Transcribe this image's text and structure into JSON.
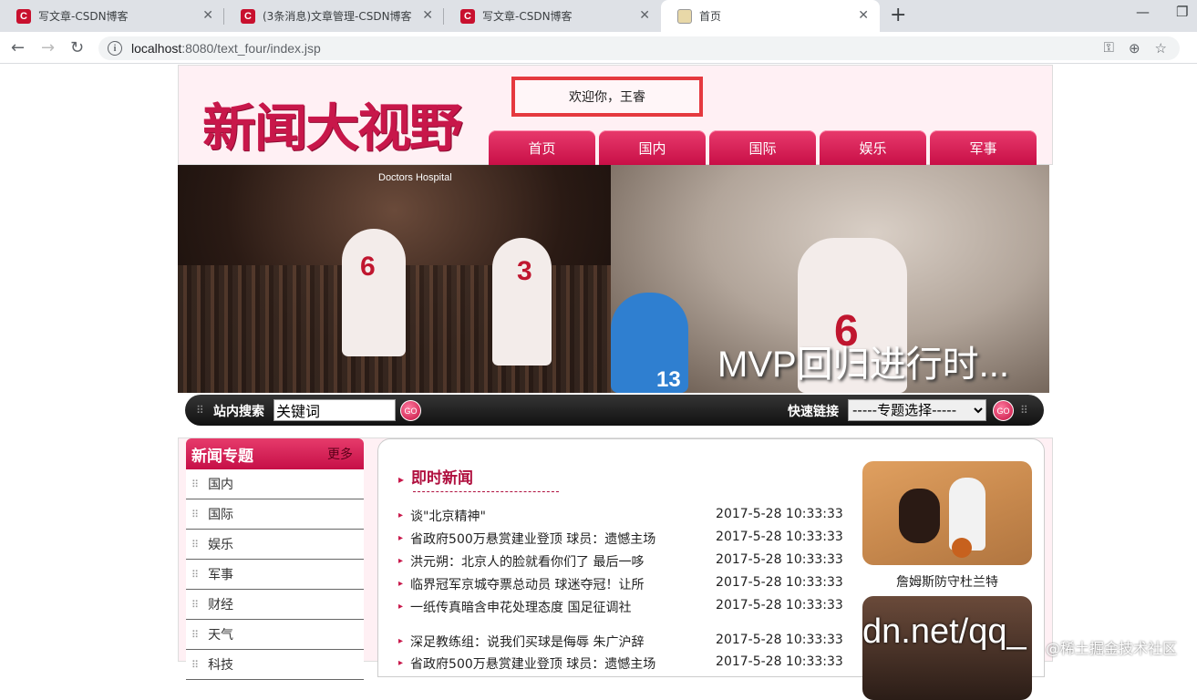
{
  "browser": {
    "tabs": [
      {
        "title": "写文章-CSDN博客",
        "favicon": "C"
      },
      {
        "title": "(3条消息)文章管理-CSDN博客",
        "favicon": "C"
      },
      {
        "title": "写文章-CSDN博客",
        "favicon": "C"
      },
      {
        "title": "首页",
        "favicon": ""
      }
    ],
    "url_host": "localhost",
    "url_path": ":8080/text_four/index.jsp"
  },
  "header": {
    "logo_text": "新闻大视野",
    "welcome": "欢迎你，王睿",
    "nav": [
      "首页",
      "国内",
      "国际",
      "娱乐",
      "军事"
    ]
  },
  "banner": {
    "caption": "MVP回归进行时...",
    "sponsor": "Doctors Hospital",
    "jersey_left": "6",
    "jersey_mid": "3",
    "jersey_right": "6",
    "jersey_opp": "13"
  },
  "search": {
    "label": "站内搜索",
    "input_value": "关键词",
    "go": "GO",
    "quick_label": "快速链接",
    "select_value": "-----专题选择-----"
  },
  "sidebar": {
    "title": "新闻专题",
    "more": "更多",
    "items": [
      "国内",
      "国际",
      "娱乐",
      "军事",
      "财经",
      "天气",
      "科技"
    ]
  },
  "news": {
    "title": "即时新闻",
    "items": [
      {
        "text": "谈\"北京精神\"",
        "date": "2017-5-28 10:33:33"
      },
      {
        "text": "省政府500万悬赏建业登顶 球员：遗憾主场",
        "date": "2017-5-28 10:33:33"
      },
      {
        "text": "洪元朔：北京人的脸就看你们了 最后一哆",
        "date": "2017-5-28 10:33:33"
      },
      {
        "text": "临界冠军京城夺票总动员 球迷夺冠！让所",
        "date": "2017-5-28 10:33:33"
      },
      {
        "text": "一纸传真暗含申花处理态度 国足征调社",
        "date": "2017-5-28 10:33:33"
      },
      {
        "text": "深足教练组：说我们买球是侮辱 朱广沪辞",
        "date": "2017-5-28 10:33:33"
      },
      {
        "text": "省政府500万悬赏建业登顶 球员：遗憾主场",
        "date": "2017-5-28 10:33:33"
      }
    ],
    "photo_caption": "詹姆斯防守杜兰特"
  },
  "watermark": {
    "text": "dn.net/qq_",
    "site": "@稀土掘金技术社区"
  }
}
